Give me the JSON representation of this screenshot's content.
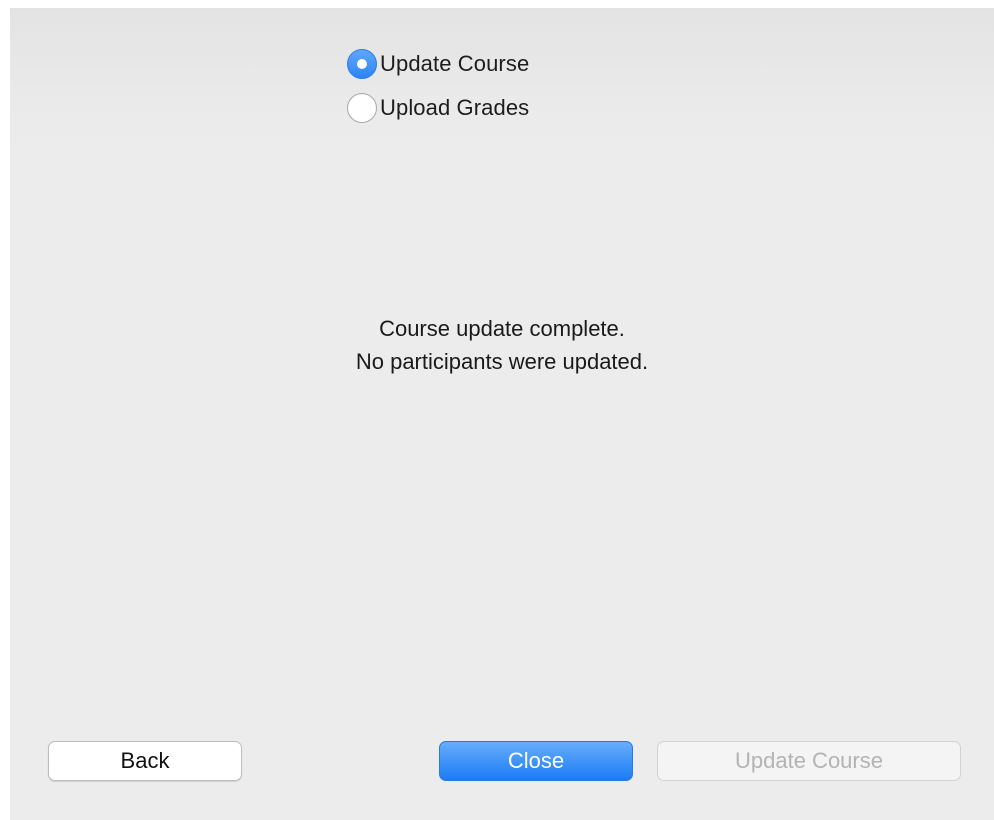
{
  "options": [
    {
      "label": "Update Course",
      "selected": true
    },
    {
      "label": "Upload Grades",
      "selected": false
    }
  ],
  "message": {
    "line1": "Course update complete.",
    "line2": "No participants were updated."
  },
  "buttons": {
    "back": "Back",
    "close": "Close",
    "update_course": "Update Course"
  },
  "colors": {
    "accent": "#2d84f7",
    "background": "#ececec",
    "disabled_text": "#b3b3b3"
  }
}
